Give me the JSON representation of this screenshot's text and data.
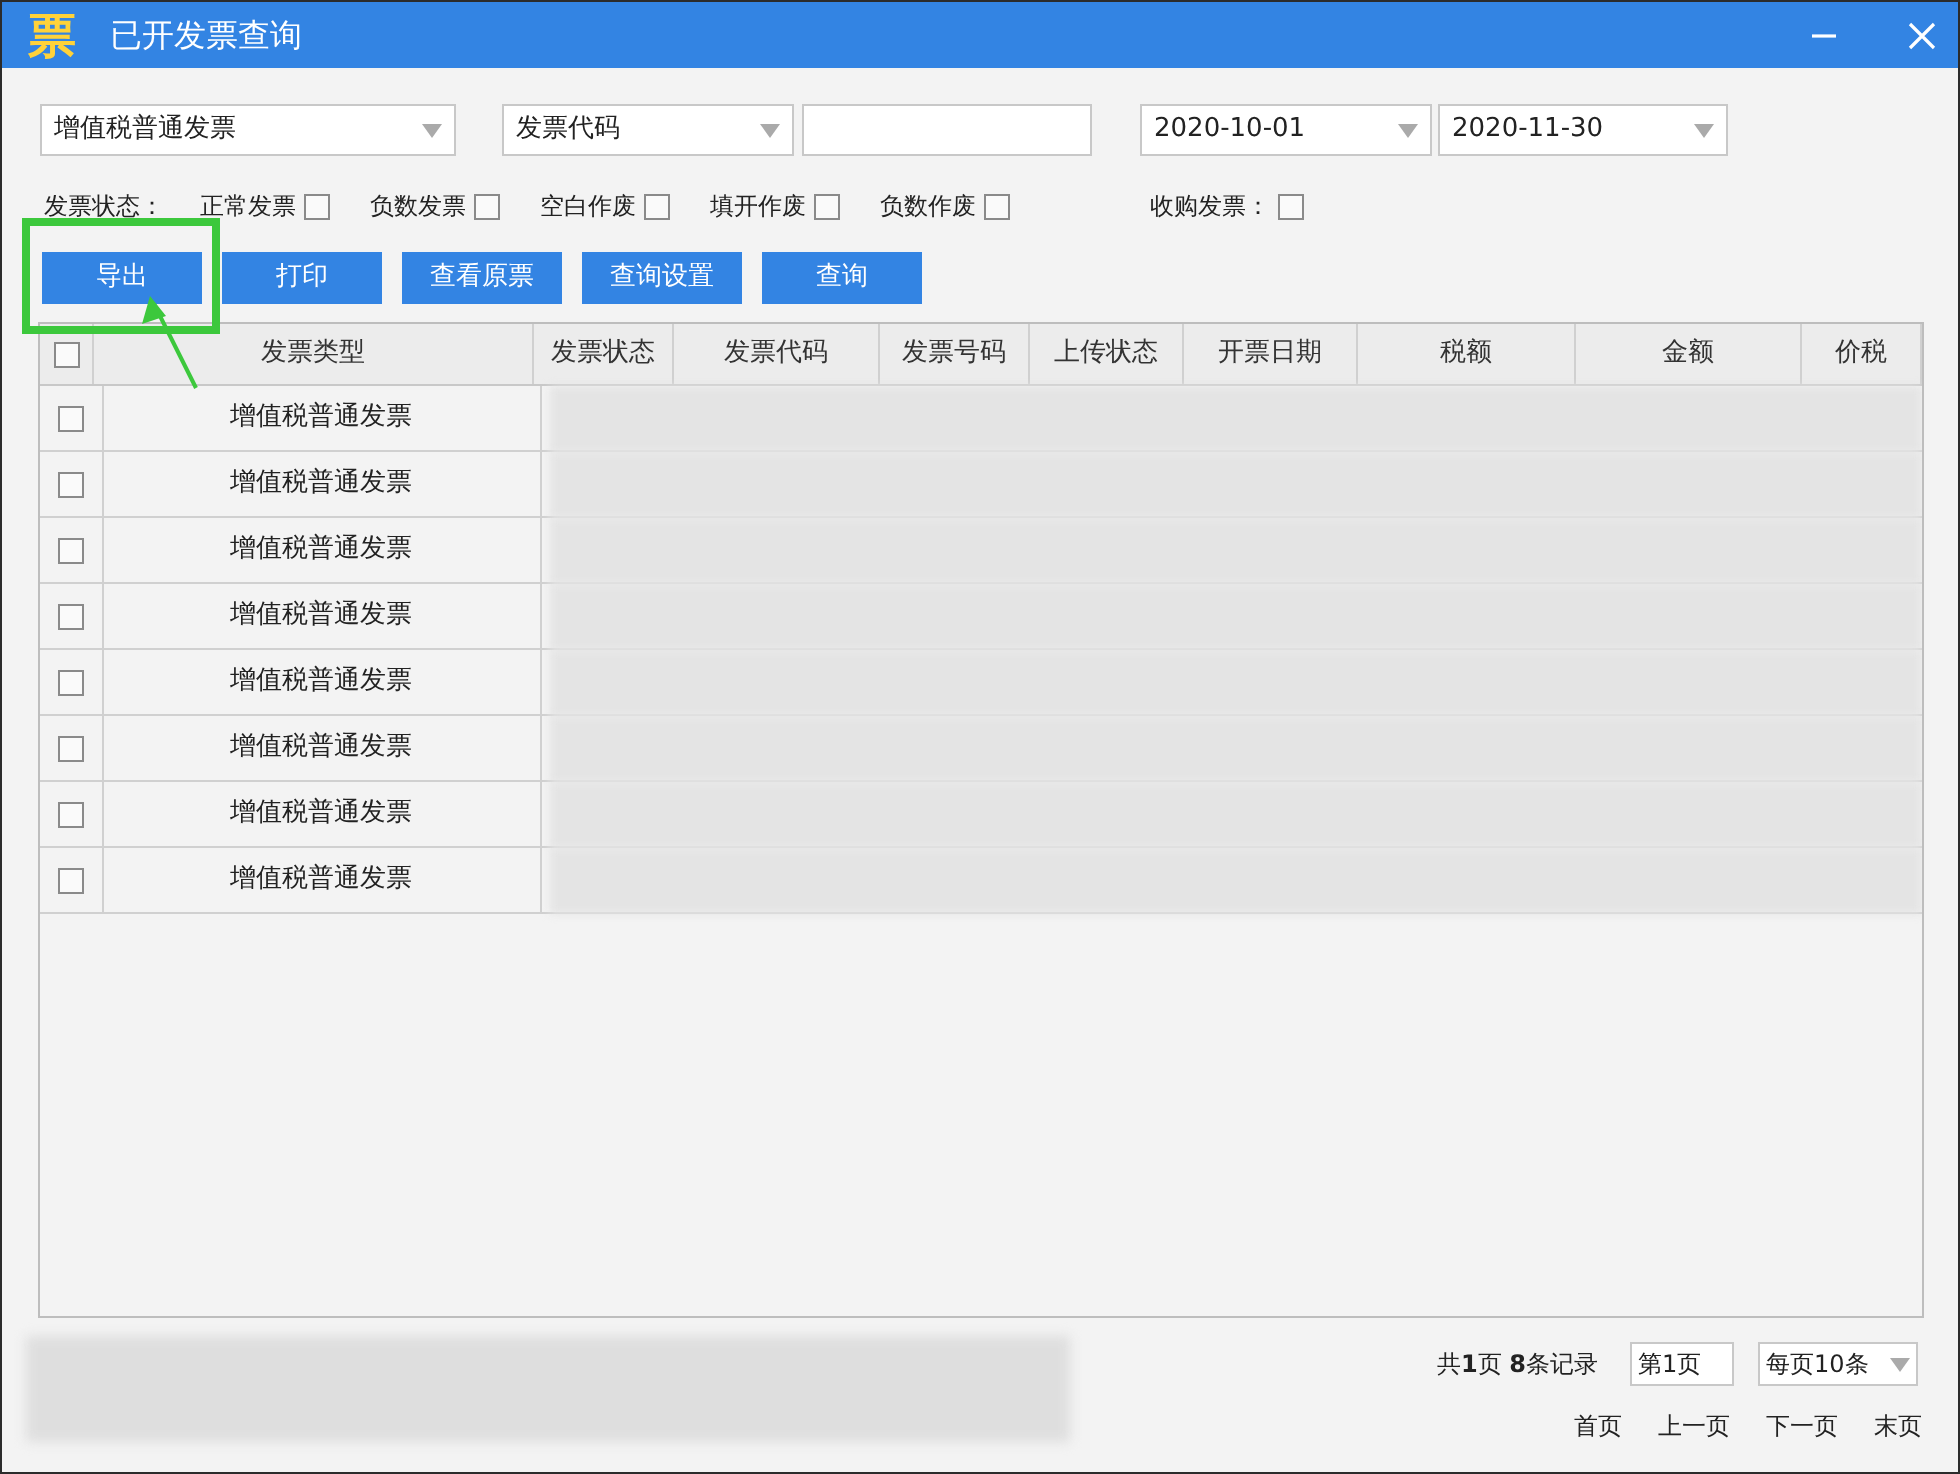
{
  "window": {
    "title": "已开发票查询",
    "logo": "票"
  },
  "filters": {
    "invoice_type": "增值税普通发票",
    "field": "发票代码",
    "date_from": "2020-10-01",
    "date_to": "2020-11-30"
  },
  "status_label": "发票状态：",
  "status_options": [
    {
      "label": "正常发票",
      "checked": false
    },
    {
      "label": "负数发票",
      "checked": false
    },
    {
      "label": "空白作废",
      "checked": false
    },
    {
      "label": "填开作废",
      "checked": false
    },
    {
      "label": "负数作废",
      "checked": false
    }
  ],
  "purchase_option": {
    "label": "收购发票：",
    "checked": false
  },
  "buttons": [
    {
      "label": "导出",
      "highlighted": true
    },
    {
      "label": "打印",
      "highlighted": false
    },
    {
      "label": "查看原票",
      "highlighted": false
    },
    {
      "label": "查询设置",
      "highlighted": false
    },
    {
      "label": "查询",
      "highlighted": false
    }
  ],
  "table": {
    "select_all_checked": false,
    "columns": [
      "发票类型",
      "发票状态",
      "发票代码",
      "发票号码",
      "上传状态",
      "开票日期",
      "税额",
      "金额",
      "价税"
    ],
    "rows": [
      {
        "type": "增值税普通发票",
        "checked": false
      },
      {
        "type": "增值税普通发票",
        "checked": false
      },
      {
        "type": "增值税普通发票",
        "checked": false
      },
      {
        "type": "增值税普通发票",
        "checked": false
      },
      {
        "type": "增值税普通发票",
        "checked": false
      },
      {
        "type": "增值税普通发票",
        "checked": false
      },
      {
        "type": "增值税普通发票",
        "checked": false
      },
      {
        "type": "增值税普通发票",
        "checked": false
      }
    ]
  },
  "pagination": {
    "summary": "共**1**页 **8**条记录",
    "page": "第1页",
    "page_size": "每页10条",
    "links": [
      "首页",
      "上一页",
      "下一页",
      "末页"
    ]
  }
}
